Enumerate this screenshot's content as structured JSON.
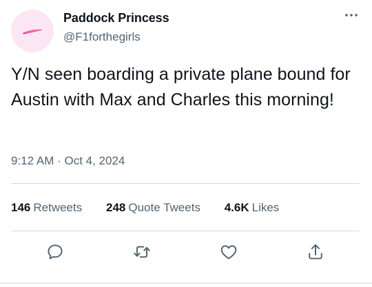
{
  "tweet": {
    "display_name": "Paddock Princess",
    "handle": "@F1forthegirls",
    "text": "Y/N seen boarding a private plane bound for Austin with Max and Charles this morning!",
    "timestamp": "9:12 AM · Oct 4, 2024",
    "avatar_icon": "pink-brushstroke-avatar",
    "more_icon": "more-horizontal-icon"
  },
  "stats": {
    "retweets_count": "146",
    "retweets_label": "Retweets",
    "quote_tweets_count": "248",
    "quote_tweets_label": "Quote Tweets",
    "likes_count": "4.6K",
    "likes_label": "Likes"
  },
  "actions": [
    {
      "name": "reply",
      "icon": "reply-icon"
    },
    {
      "name": "retweet",
      "icon": "retweet-icon"
    },
    {
      "name": "like",
      "icon": "heart-icon"
    },
    {
      "name": "share",
      "icon": "share-icon"
    }
  ],
  "colors": {
    "text": "#0f1419",
    "secondary": "#536471",
    "divider": "#cfd9de",
    "avatar_bg": "#fbe7f4",
    "avatar_stroke": "#e04a9a"
  }
}
